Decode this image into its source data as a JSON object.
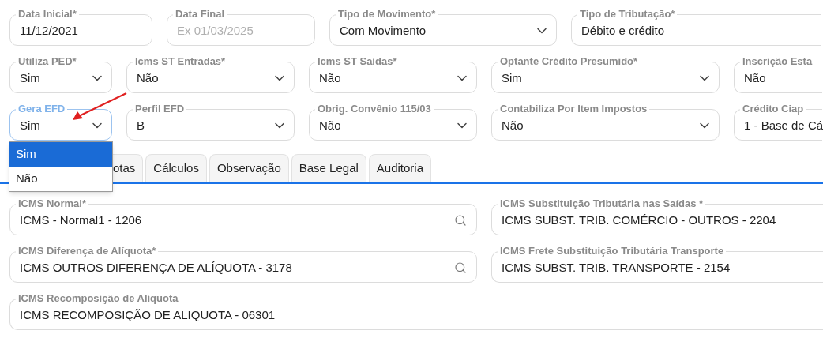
{
  "top_fields": [
    [
      {
        "kind": "date",
        "label": "Data Inicial*",
        "value": "11/12/2021"
      },
      {
        "kind": "date",
        "label": "Data Final",
        "placeholder": "Ex 01/03/2025"
      },
      {
        "kind": "select",
        "label": "Tipo de Movimento*",
        "value": "Com Movimento"
      },
      {
        "kind": "text",
        "label": "Tipo de Tributação*",
        "value": "Débito e crédito"
      }
    ],
    [
      {
        "kind": "select",
        "label": "Utiliza PED*",
        "value": "Sim"
      },
      {
        "kind": "select",
        "label": "Icms ST Entradas*",
        "value": "Não"
      },
      {
        "kind": "select",
        "label": "Icms ST Saídas*",
        "value": "Não"
      },
      {
        "kind": "select",
        "label": "Optante Crédito Presumido*",
        "value": "Sim"
      },
      {
        "kind": "text",
        "label": "Inscrição Esta",
        "value": "Não"
      }
    ],
    [
      {
        "kind": "select",
        "label": "Gera EFD",
        "value": "Sim",
        "focused": true
      },
      {
        "kind": "select",
        "label": "Perfil EFD",
        "value": "B"
      },
      {
        "kind": "select",
        "label": "Obrig. Convênio 115/03",
        "value": "Não"
      },
      {
        "kind": "select",
        "label": "Contabiliza Por Item Impostos",
        "value": "Não"
      },
      {
        "kind": "text",
        "label": "Crédito Ciap",
        "value": "1 - Base de Cá"
      }
    ]
  ],
  "dropdown": {
    "options": [
      {
        "label": "Sim",
        "selected": true
      },
      {
        "label": "Não",
        "selected": false
      }
    ]
  },
  "tabs": [
    {
      "label": "otas",
      "selected": false
    },
    {
      "label": "Cálculos",
      "selected": false
    },
    {
      "label": "Observação",
      "selected": false
    },
    {
      "label": "Base Legal",
      "selected": false
    },
    {
      "label": "Auditoria",
      "selected": false
    }
  ],
  "tab_fields": [
    [
      {
        "kind": "search",
        "label": "ICMS Normal*",
        "value": "ICMS - Normal1 - 1206"
      },
      {
        "kind": "text",
        "label": "ICMS Substituição Tributária nas Saídas *",
        "value": "ICMS SUBST. TRIB. COMÉRCIO - OUTROS - 2204"
      }
    ],
    [
      {
        "kind": "search",
        "label": "ICMS Diferença de Alíquota*",
        "value": "ICMS OUTROS DIFERENÇA DE ALÍQUOTA - 3178"
      },
      {
        "kind": "text",
        "label": "ICMS Frete Substituição Tributária Transporte",
        "value": "ICMS SUBST. TRIB. TRANSPORTE - 2154"
      }
    ],
    [
      {
        "kind": "text",
        "label": "ICMS Recomposição de Alíquota",
        "value": "ICMS RECOMPOSIÇÃO DE ALIQUOTA - 06301"
      }
    ]
  ]
}
